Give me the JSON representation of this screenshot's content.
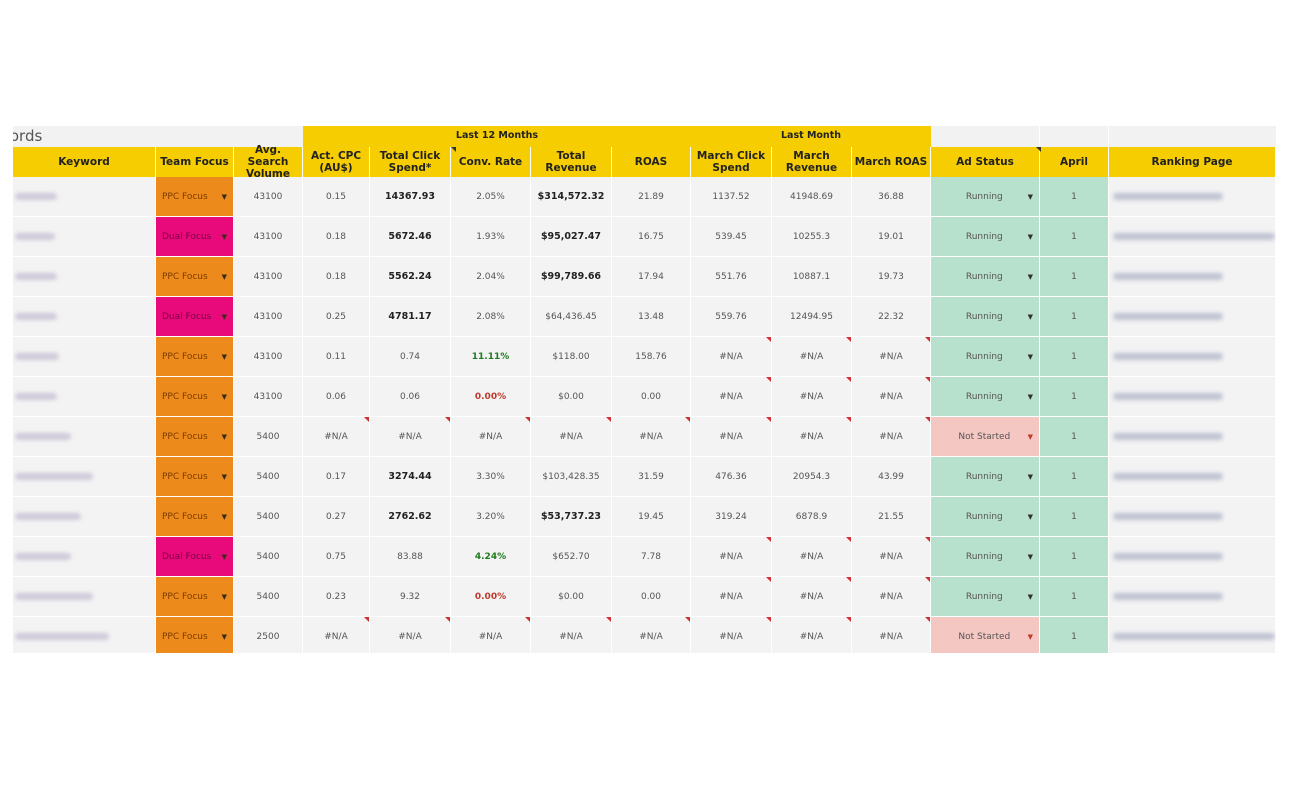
{
  "sheet": {
    "title_fragment": "vords",
    "group_headers": {
      "last12": "Last 12 Months",
      "lastmonth": "Last Month"
    },
    "columns": [
      "Keyword",
      "Team Focus",
      "Avg. Search Volume",
      "Act. CPC (AU$)",
      "Total Click Spend*",
      "Conv. Rate",
      "Total Revenue",
      "ROAS",
      "March Click Spend",
      "March Revenue",
      "March ROAS",
      "Ad Status",
      "April",
      "Ranking Page"
    ],
    "rows": [
      {
        "focus": "PPC Focus",
        "vol": "43100",
        "cpc": "0.15",
        "spend": "14367.93",
        "conv": "2.05%",
        "rev": "$314,572.32",
        "roas": "21.89",
        "mspend": "1137.52",
        "mrev": "41948.69",
        "mroas": "36.88",
        "status": "Running",
        "april": "1"
      },
      {
        "focus": "Dual Focus",
        "vol": "43100",
        "cpc": "0.18",
        "spend": "5672.46",
        "conv": "1.93%",
        "rev": "$95,027.47",
        "roas": "16.75",
        "mspend": "539.45",
        "mrev": "10255.3",
        "mroas": "19.01",
        "status": "Running",
        "april": "1"
      },
      {
        "focus": "PPC Focus",
        "vol": "43100",
        "cpc": "0.18",
        "spend": "5562.24",
        "conv": "2.04%",
        "rev": "$99,789.66",
        "roas": "17.94",
        "mspend": "551.76",
        "mrev": "10887.1",
        "mroas": "19.73",
        "status": "Running",
        "april": "1"
      },
      {
        "focus": "Dual Focus",
        "vol": "43100",
        "cpc": "0.25",
        "spend": "4781.17",
        "conv": "2.08%",
        "rev": "$64,436.45",
        "roas": "13.48",
        "mspend": "559.76",
        "mrev": "12494.95",
        "mroas": "22.32",
        "status": "Running",
        "april": "1"
      },
      {
        "focus": "PPC Focus",
        "vol": "43100",
        "cpc": "0.11",
        "spend": "0.74",
        "conv": "11.11%",
        "rev": "$118.00",
        "roas": "158.76",
        "mspend": "#N/A",
        "mrev": "#N/A",
        "mroas": "#N/A",
        "status": "Running",
        "april": "1"
      },
      {
        "focus": "PPC Focus",
        "vol": "43100",
        "cpc": "0.06",
        "spend": "0.06",
        "conv": "0.00%",
        "rev": "$0.00",
        "roas": "0.00",
        "mspend": "#N/A",
        "mrev": "#N/A",
        "mroas": "#N/A",
        "status": "Running",
        "april": "1"
      },
      {
        "focus": "PPC Focus",
        "vol": "5400",
        "cpc": "#N/A",
        "spend": "#N/A",
        "conv": "#N/A",
        "rev": "#N/A",
        "roas": "#N/A",
        "mspend": "#N/A",
        "mrev": "#N/A",
        "mroas": "#N/A",
        "status": "Not Started",
        "april": "1"
      },
      {
        "focus": "PPC Focus",
        "vol": "5400",
        "cpc": "0.17",
        "spend": "3274.44",
        "conv": "3.30%",
        "rev": "$103,428.35",
        "roas": "31.59",
        "mspend": "476.36",
        "mrev": "20954.3",
        "mroas": "43.99",
        "status": "Running",
        "april": "1"
      },
      {
        "focus": "PPC Focus",
        "vol": "5400",
        "cpc": "0.27",
        "spend": "2762.62",
        "conv": "3.20%",
        "rev": "$53,737.23",
        "roas": "19.45",
        "mspend": "319.24",
        "mrev": "6878.9",
        "mroas": "21.55",
        "status": "Running",
        "april": "1"
      },
      {
        "focus": "Dual Focus",
        "vol": "5400",
        "cpc": "0.75",
        "spend": "83.88",
        "conv": "4.24%",
        "rev": "$652.70",
        "roas": "7.78",
        "mspend": "#N/A",
        "mrev": "#N/A",
        "mroas": "#N/A",
        "status": "Running",
        "april": "1"
      },
      {
        "focus": "PPC Focus",
        "vol": "5400",
        "cpc": "0.23",
        "spend": "9.32",
        "conv": "0.00%",
        "rev": "$0.00",
        "roas": "0.00",
        "mspend": "#N/A",
        "mrev": "#N/A",
        "mroas": "#N/A",
        "status": "Running",
        "april": "1"
      },
      {
        "focus": "PPC Focus",
        "vol": "2500",
        "cpc": "#N/A",
        "spend": "#N/A",
        "conv": "#N/A",
        "rev": "#N/A",
        "roas": "#N/A",
        "mspend": "#N/A",
        "mrev": "#N/A",
        "mroas": "#N/A",
        "status": "Not Started",
        "april": "1"
      }
    ]
  },
  "colors": {
    "header": "#f5cd00",
    "ppc_focus": "#ec8a1c",
    "dual_focus": "#e8097a",
    "running": "#b7e1cd",
    "not_started": "#f4c7c3",
    "positive": "#1e7b1e",
    "negative": "#c0392b"
  },
  "icons": {
    "dropdown": "dropdown-arrow-icon",
    "error_marker": "error-flag-icon"
  }
}
